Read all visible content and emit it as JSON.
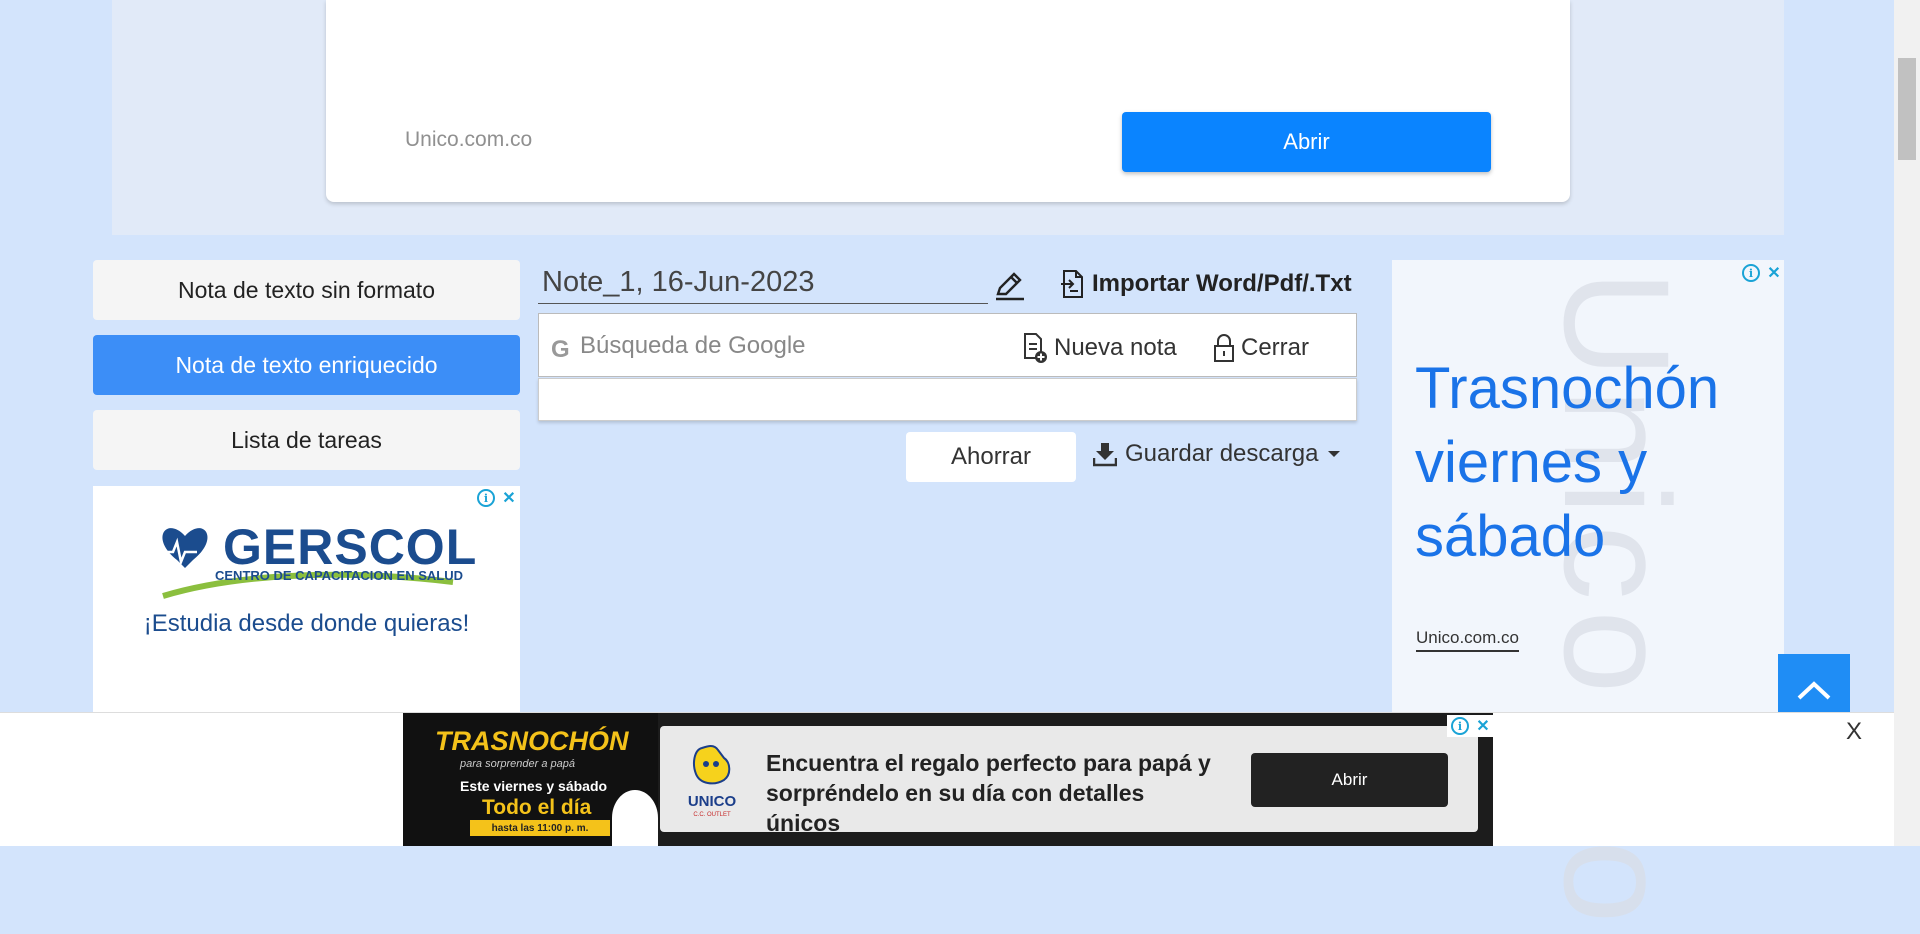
{
  "top_ad": {
    "domain": "Unico.com.co",
    "button": "Abrir"
  },
  "nav": {
    "plain": "Nota de texto sin formato",
    "rich": "Nota de texto enriquecido",
    "tasks": "Lista de tareas"
  },
  "left_ad": {
    "brand": "GERSCOL",
    "subtitle": "CENTRO DE CAPACITACION EN SALUD",
    "slogan": "¡Estudia desde donde quieras!"
  },
  "note": {
    "title": "Note_1, 16-Jun-2023",
    "import_label": "Importar Word/Pdf/.Txt",
    "search_placeholder": "Búsqueda de Google",
    "new_note": "Nueva nota",
    "close": "Cerrar",
    "save": "Ahorrar",
    "download": "Guardar descarga"
  },
  "right_ad": {
    "watermark": "Unico.co",
    "headline": "Trasnochón viernes y sábado",
    "domain": "Unico.com.co"
  },
  "bottom_ad": {
    "title": "TRASNOCHÓN",
    "subtitle": "para sorprender a papá",
    "days": "Este viernes y sábado",
    "all_day": "Todo el día",
    "hours": "hasta las 11:00 p. m.",
    "logo_text": "UNICO",
    "logo_sub": "C.C. OUTLET",
    "message": "Encuentra el regalo perfecto para papá y sorpréndelo en su día con detalles únicos",
    "button": "Abrir",
    "close": "X"
  },
  "colors": {
    "page_bg": "#d3e4fc",
    "primary": "#0a84ff",
    "nav_active": "#3c8ef7",
    "headline_blue": "#1a73e8",
    "promo_yellow": "#f4c21a"
  }
}
